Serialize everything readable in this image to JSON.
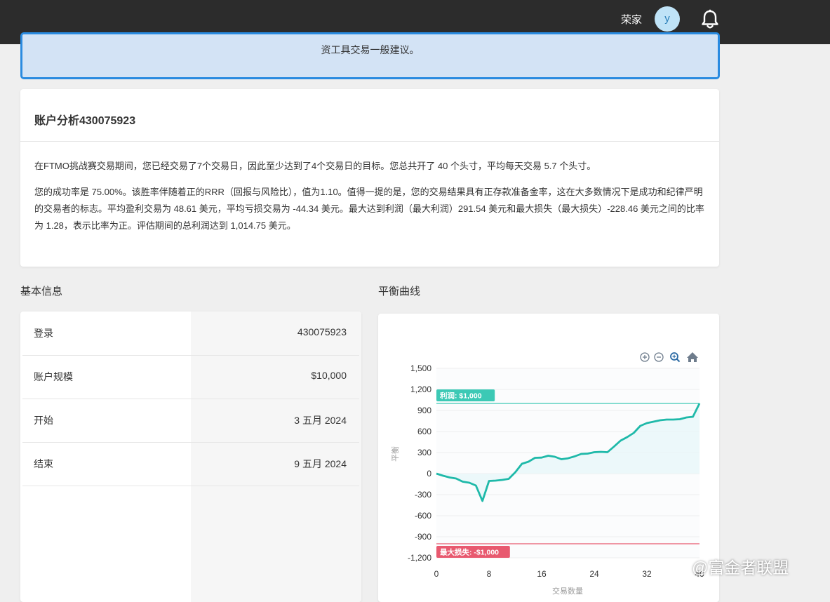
{
  "header": {
    "user_name": "荣家",
    "avatar_letter": "y"
  },
  "notice": {
    "text": "资工具交易一般建议。"
  },
  "analysis": {
    "title": "账户分析430075923",
    "paragraph1": "在FTMO挑战赛交易期间，您已经交易了7个交易日，因此至少达到了4个交易日的目标。您总共开了 40 个头寸，平均每天交易 5.7 个头寸。",
    "paragraph2": "您的成功率是 75.00%。该胜率伴随着正的RRR（回报与风险比），值为1.10。值得一提的是，您的交易结果具有正存款准备金率，这在大多数情况下是成功和纪律严明的交易者的标志。平均盈利交易为 48.61 美元，平均亏损交易为 -44.34 美元。最大达到利润（最大利润）291.54 美元和最大损失（最大损失）-228.46 美元之间的比率为 1.28，表示比率为正。评估期间的总利润达到 1,014.75 美元。"
  },
  "basic_info": {
    "title": "基本信息",
    "rows": [
      {
        "key": "登录",
        "value": "430075923"
      },
      {
        "key": "账户规模",
        "value": "$10,000"
      },
      {
        "key": "开始",
        "value": "3 五月 2024"
      },
      {
        "key": "结束",
        "value": "9 五月 2024"
      }
    ]
  },
  "balance_curve": {
    "title": "平衡曲线",
    "toolbar_icons": [
      "zoom-in-icon",
      "zoom-out-icon",
      "search-zoom-icon",
      "home-icon"
    ]
  },
  "chart_data": {
    "type": "line",
    "xlabel": "交易数量",
    "ylabel": "平衡",
    "xlim": [
      0,
      40
    ],
    "ylim": [
      -1200,
      1500
    ],
    "x_ticks": [
      0,
      8,
      16,
      24,
      32,
      40
    ],
    "x_tick_labels": [
      "0",
      "8",
      "16",
      "24",
      "32",
      "40"
    ],
    "y_ticks": [
      1500,
      1200,
      900,
      600,
      300,
      0,
      -300,
      -600,
      -900,
      -1200
    ],
    "y_tick_labels": [
      "1,500",
      "1,200",
      "900",
      "600",
      "300",
      "0",
      "-300",
      "-600",
      "-900",
      "-1,200"
    ],
    "line_color": "#1fb9a9",
    "series": [
      {
        "x": [
          0,
          1,
          2,
          3,
          4,
          5,
          6,
          7,
          8,
          9,
          10,
          11,
          12,
          13,
          14,
          15,
          16,
          17,
          18,
          19,
          20,
          21,
          22,
          23,
          24,
          25,
          26,
          27,
          28,
          29,
          30,
          31,
          32,
          33,
          34,
          35,
          36,
          37,
          38,
          39,
          40
        ],
        "values": [
          0,
          -30,
          -55,
          -70,
          -115,
          -130,
          -170,
          -390,
          -105,
          -100,
          -90,
          -75,
          20,
          140,
          170,
          225,
          228,
          255,
          240,
          205,
          218,
          245,
          280,
          285,
          305,
          310,
          305,
          385,
          470,
          520,
          580,
          680,
          720,
          740,
          760,
          770,
          770,
          775,
          800,
          810,
          1000
        ]
      }
    ],
    "reference_lines": [
      {
        "label": "利润:  $1,000",
        "value": 1000,
        "color": "#3cc9b5"
      },
      {
        "label": "最大损失:  -$1,000",
        "value": -1000,
        "color": "#e8596f"
      }
    ]
  },
  "watermark": "@富金者联盟"
}
